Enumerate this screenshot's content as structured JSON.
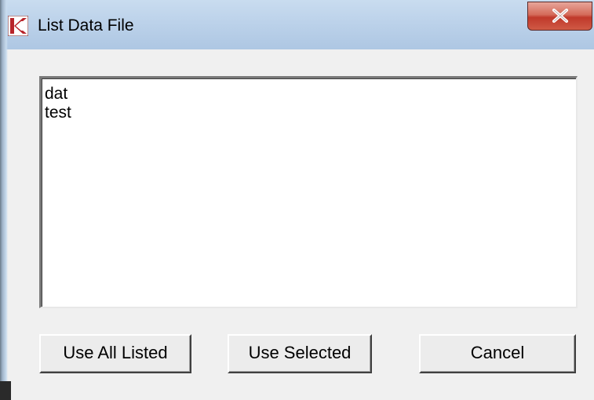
{
  "window": {
    "title": "List Data File",
    "title_icon": "k-app-icon",
    "close_icon": "close-x-icon"
  },
  "listbox": {
    "items": [
      {
        "label": "dat"
      },
      {
        "label": "test"
      }
    ]
  },
  "buttons": {
    "use_all_listed": "Use All Listed",
    "use_selected": "Use Selected",
    "cancel": "Cancel"
  },
  "colors": {
    "titlebar": "#bcd2ea",
    "close_button": "#c0392b",
    "icon_red": "#c0392b",
    "client_bg": "#f0f0f0"
  }
}
